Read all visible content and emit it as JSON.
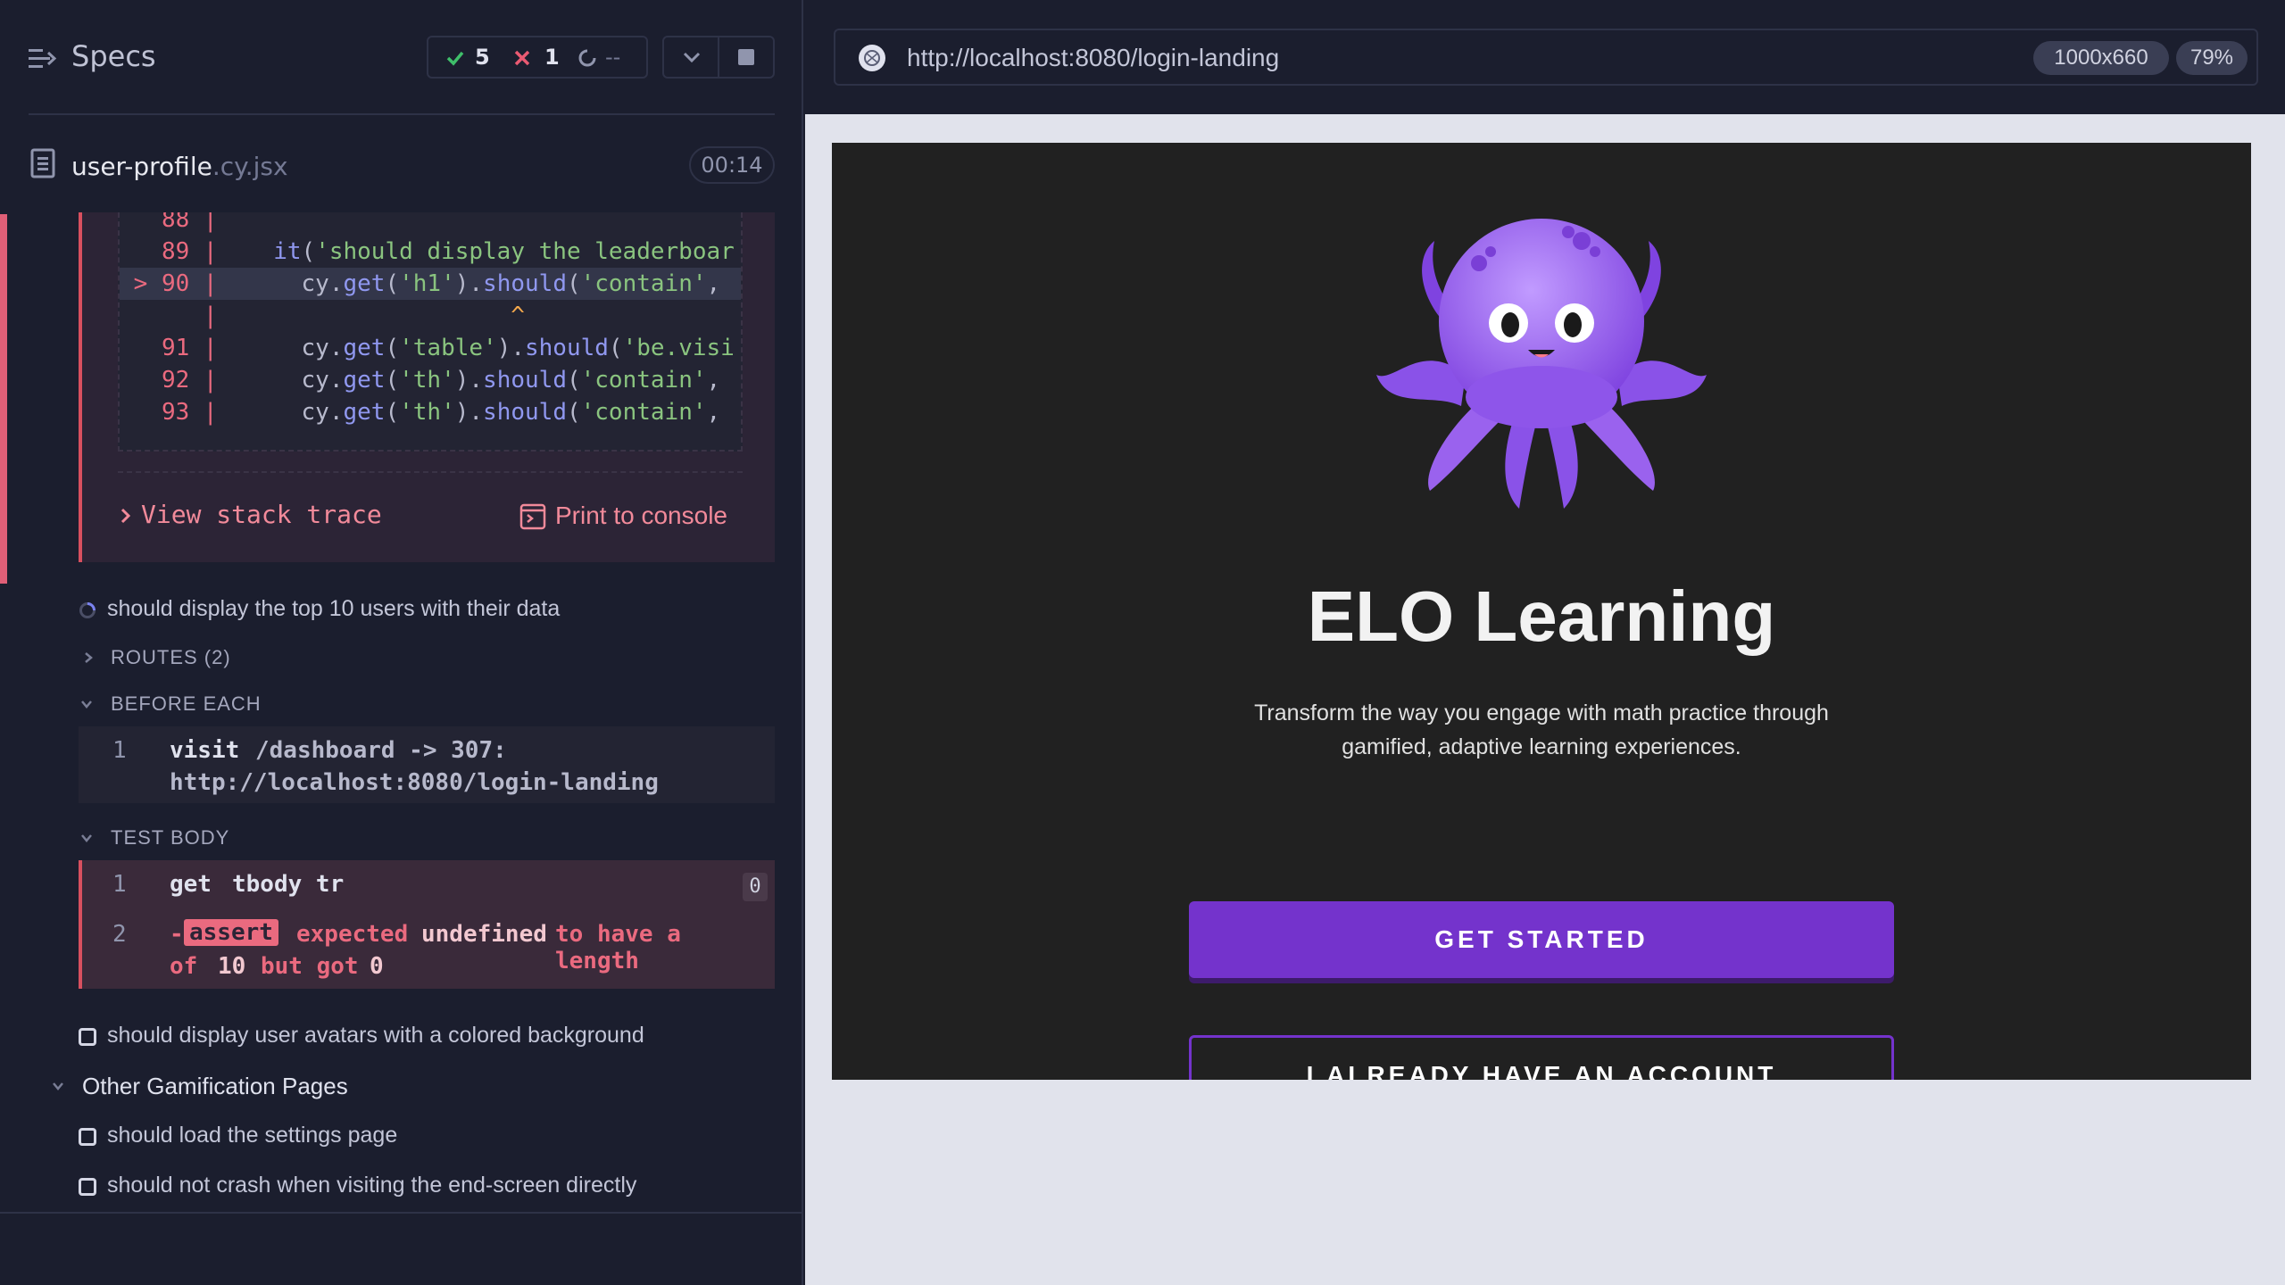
{
  "reporter": {
    "specs_label": "Specs",
    "stats": {
      "passed": "5",
      "failed": "1",
      "pending": "--"
    },
    "file": {
      "name": "user-profile",
      "ext": ".cy.jsx",
      "duration": "00:14"
    }
  },
  "error": {
    "code_lines": [
      {
        "num": "88",
        "marker": "",
        "code": ""
      },
      {
        "num": "89",
        "marker": "",
        "code": "    it('should display the leaderboar"
      },
      {
        "num": "90",
        "marker": ">",
        "code": "      cy.get('h1').should('contain',"
      },
      {
        "num": "",
        "marker": "",
        "code": "                     ^"
      },
      {
        "num": "91",
        "marker": "",
        "code": "      cy.get('table').should('be.visi"
      },
      {
        "num": "92",
        "marker": "",
        "code": "      cy.get('th').should('contain',"
      },
      {
        "num": "93",
        "marker": "",
        "code": "      cy.get('th').should('contain',"
      }
    ],
    "stack_trace_label": "View stack trace",
    "print_label": "Print to console"
  },
  "tests": {
    "running": "should display the top 10 users with their data",
    "routes_label": "ROUTES (2)",
    "before_each_label": "BEFORE EACH",
    "before_each_cmd": {
      "index": "1",
      "name": "visit",
      "message_line1": "/dashboard -> 307:",
      "message_line2": "http://localhost:8080/login-landing"
    },
    "test_body_label": "TEST BODY",
    "body_cmd1": {
      "index": "1",
      "name": "get",
      "message": "tbody tr",
      "count": "0"
    },
    "body_cmd2": {
      "index": "2",
      "prefix": "-",
      "name": "assert",
      "line1": [
        "expected",
        "undefined",
        "to have a length"
      ],
      "line2": [
        "of",
        "10",
        "but got",
        "0"
      ]
    },
    "avatars": "should display user avatars with a colored background",
    "suite": "Other Gamification Pages",
    "settings": "should load the settings page",
    "end_screen": "should not crash when visiting the end-screen directly"
  },
  "browser": {
    "url": "http://localhost:8080/login-landing",
    "viewport": "1000x660",
    "zoom": "79%"
  },
  "app": {
    "title": "ELO Learning",
    "description": "Transform the way you engage with math practice through gamified, adaptive learning experiences.",
    "primary_button": "GET STARTED",
    "secondary_button": "I ALREADY HAVE AN ACCOUNT",
    "accent_color": "#7433cc"
  }
}
